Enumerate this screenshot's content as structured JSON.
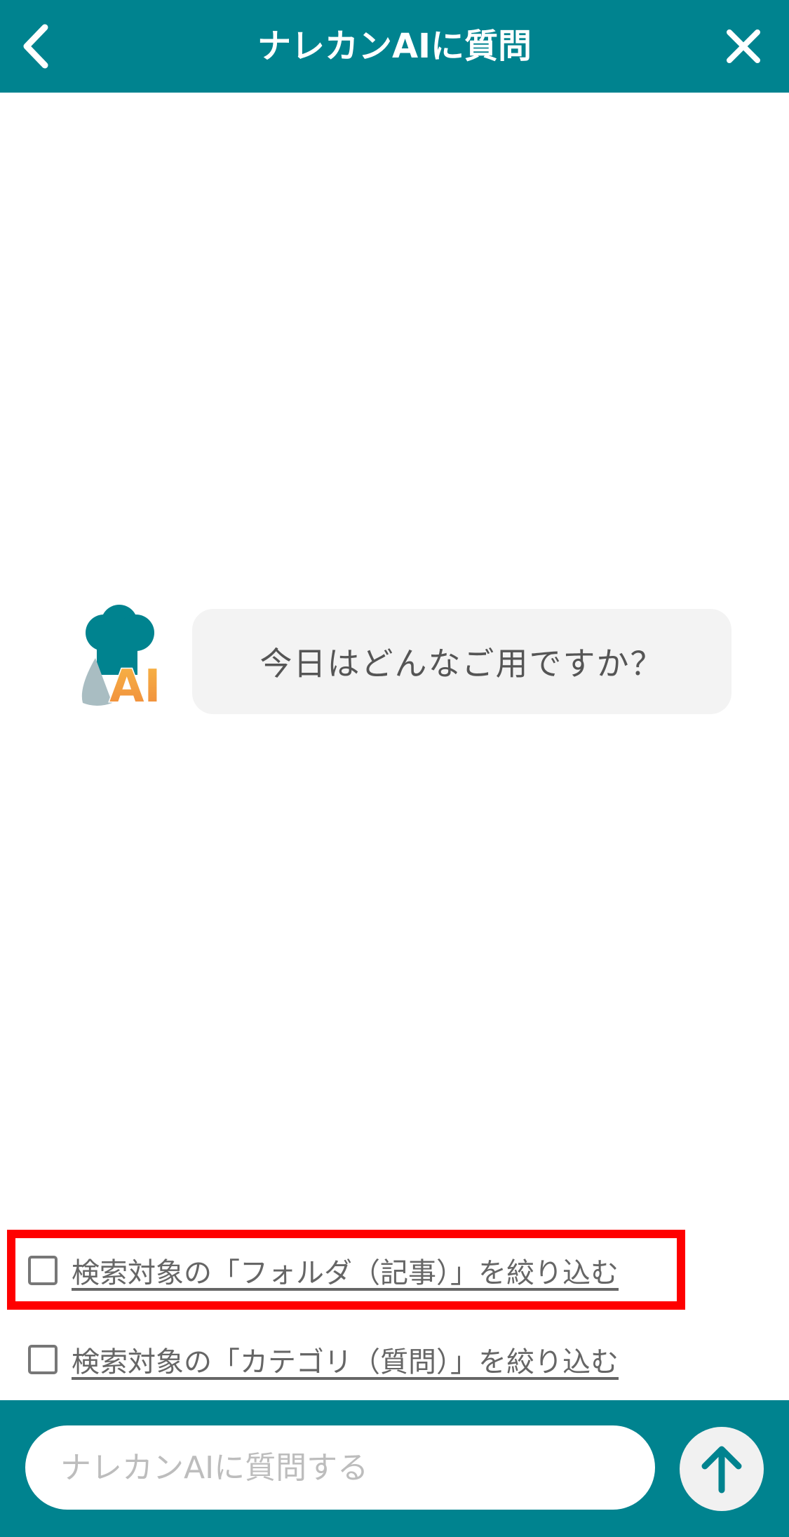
{
  "header": {
    "title": "ナレカンAIに質問",
    "back_icon": "chevron-left-icon",
    "close_icon": "close-icon"
  },
  "chat": {
    "avatar_text": "AI",
    "message": "今日はどんなご用ですか？"
  },
  "filters": [
    {
      "label": "検索対象の「フォルダ（記事）」を絞り込む",
      "checked": false
    },
    {
      "label": "検索対象の「カテゴリ（質問）」を絞り込む",
      "checked": false
    }
  ],
  "footer": {
    "input_placeholder": "ナレカンAIに質問する",
    "input_value": "",
    "send_icon": "arrow-up-icon"
  },
  "colors": {
    "brand": "#00838F",
    "highlight": "#FF0000",
    "bubble": "#F3F3F3",
    "ai_text_gradient_start": "#F7B545",
    "ai_text_gradient_end": "#F08A3C"
  }
}
